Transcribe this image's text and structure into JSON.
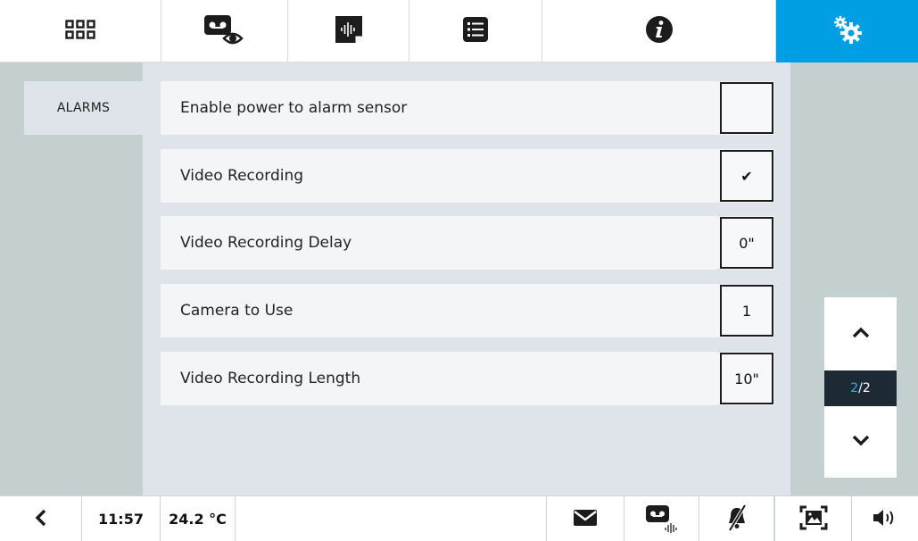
{
  "top_tabs": [
    {
      "name": "apps-grid-icon",
      "active": false
    },
    {
      "name": "video-memory-icon",
      "active": false
    },
    {
      "name": "audio-memo-icon",
      "active": false
    },
    {
      "name": "list-icon",
      "active": false
    },
    {
      "name": "info-icon",
      "active": false
    },
    {
      "name": "settings-gears-icon",
      "active": true
    }
  ],
  "sidebar": {
    "items": [
      {
        "label": "ALARMS",
        "selected": true
      }
    ]
  },
  "settings": {
    "rows": [
      {
        "label": "Enable power to alarm sensor",
        "value": "",
        "type": "checkbox",
        "checked": false
      },
      {
        "label": "Video Recording",
        "value": "✔",
        "type": "checkbox",
        "checked": true
      },
      {
        "label": "Video Recording Delay",
        "value": "0\"",
        "type": "value"
      },
      {
        "label": "Camera to Use",
        "value": "1",
        "type": "value"
      },
      {
        "label": "Video Recording Length",
        "value": "10\"",
        "type": "value"
      }
    ]
  },
  "pager": {
    "current": "2",
    "separator": "/",
    "total": "2"
  },
  "bottom_bar": {
    "time": "11:57",
    "temperature": "24.2 °C",
    "icons": [
      "back-chevron-icon",
      "mail-icon",
      "video-voice-memo-icon",
      "bell-muted-icon",
      "camera-view-icon",
      "speaker-volume-icon"
    ]
  },
  "colors": {
    "accent": "#009fe3",
    "panel": "#dfe3ea",
    "side_strip": "#c4d0d0",
    "pager_bg": "#1d2a36",
    "pager_current": "#2fb0ee"
  }
}
